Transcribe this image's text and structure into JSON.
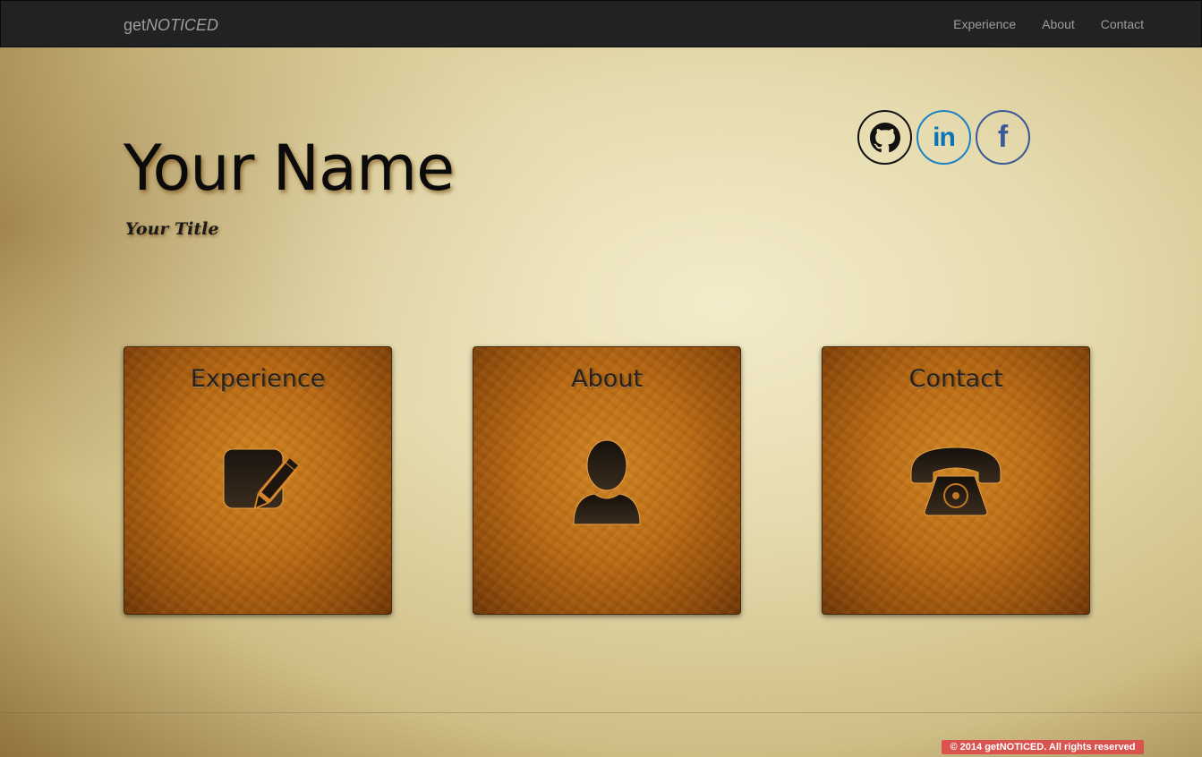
{
  "navbar": {
    "brand_prefix": "get",
    "brand_suffix": "NOTICED",
    "links": [
      {
        "label": "Experience"
      },
      {
        "label": "About"
      },
      {
        "label": "Contact"
      }
    ]
  },
  "hero": {
    "name": "Your Name",
    "title": "Your Title"
  },
  "social": [
    {
      "icon": "github-icon"
    },
    {
      "icon": "linkedin-icon",
      "text": "in"
    },
    {
      "icon": "facebook-icon",
      "text": "f"
    }
  ],
  "cards": [
    {
      "title": "Experience",
      "icon": "edit-pencil-icon"
    },
    {
      "title": "About",
      "icon": "user-icon"
    },
    {
      "title": "Contact",
      "icon": "phone-icon"
    }
  ],
  "footer": {
    "copyright": "© 2014 getNOTICED. All rights reserved"
  },
  "colors": {
    "navbar_bg": "#222222",
    "nav_text": "#9d9d9d",
    "card_leather": "#b96a14",
    "copyright_bg": "#d9534f",
    "linkedin": "#0a74b8",
    "facebook": "#3b5998"
  }
}
